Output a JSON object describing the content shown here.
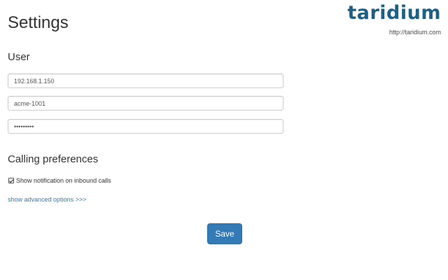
{
  "header": {
    "title": "Settings",
    "logo_text": "taridium",
    "logo_url": "http://taridium.com"
  },
  "user_section": {
    "title": "User",
    "server_value": "192.168.1.150",
    "username_value": "acme-1001",
    "password_value": "password1"
  },
  "calling_section": {
    "title": "Calling preferences",
    "notify_label": "Show notification on inbound calls",
    "notify_checked": true,
    "advanced_link": "show advanced options >>>"
  },
  "actions": {
    "save_label": "Save"
  },
  "colors": {
    "brand": "#1f5f83",
    "primary_button": "#337ab7",
    "link": "#337ab7"
  }
}
